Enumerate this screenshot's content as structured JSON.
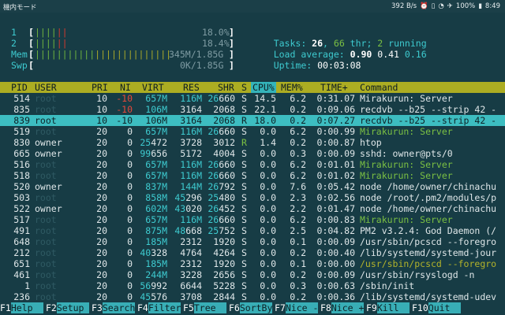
{
  "statusbar": {
    "left": "機内モード",
    "net": "392 B/s",
    "icons": [
      "alarm-icon",
      "vibrate-icon",
      "wifi-icon",
      "airplane-icon"
    ],
    "battery": "100%",
    "time": "8:49"
  },
  "meters": {
    "cpu1": {
      "label": "1",
      "value": "18.0",
      "bar_fraction": 0.18
    },
    "cpu2": {
      "label": "2",
      "value": "18.4",
      "bar_fraction": 0.18
    },
    "mem": {
      "label": "Mem",
      "value": "345M/1.85G",
      "bar_fraction": 0.55
    },
    "swp": {
      "label": "Swp",
      "value": "0K/1.85G",
      "bar_fraction": 0
    }
  },
  "summary": {
    "tasks_label": "Tasks: ",
    "tasks": "26",
    "sep": ", ",
    "thr": "66",
    "thr_label": " thr; ",
    "running": "2",
    "running_label": " running",
    "load_label": "Load average: ",
    "load1": "0.90",
    "load5": "0.41",
    "load15": "0.16",
    "uptime_label": "Uptime: ",
    "uptime": "00:03:08"
  },
  "columns": [
    "PID",
    "USER",
    "PRI",
    "NI",
    "VIRT",
    "RES",
    "SHR",
    "S",
    "CPU%",
    "MEM%",
    "TIME+",
    "Command"
  ],
  "processes": [
    {
      "pid": "514",
      "user": "root",
      "pri": "10",
      "ni": "-10",
      "virt": "657M",
      "res": "116M",
      "shr": "26660",
      "s": "S",
      "cpu": "14.5",
      "mem": "6.2",
      "time": "0:31.07",
      "cmd": "Mirakurun: Server"
    },
    {
      "pid": "835",
      "user": "root",
      "pri": "10",
      "ni": "-10",
      "virt": "106M",
      "res": "3164",
      "shr": "2068",
      "s": "S",
      "cpu": "22.1",
      "mem": "0.2",
      "time": "0:09.06",
      "cmd": "recdvb --b25 --strip 42 -"
    },
    {
      "pid": "839",
      "user": "root",
      "pri": "10",
      "ni": "-10",
      "virt": "106M",
      "res": "3164",
      "shr": "2068",
      "s": "R",
      "cpu": "18.0",
      "mem": "0.2",
      "time": "0:07.27",
      "cmd": "recdvb --b25 --strip 42 -"
    },
    {
      "pid": "519",
      "user": "root",
      "pri": "20",
      "ni": "0",
      "virt": "657M",
      "res": "116M",
      "shr": "26660",
      "s": "S",
      "cpu": "0.0",
      "mem": "6.2",
      "time": "0:00.99",
      "cmd": "Mirakurun: Server"
    },
    {
      "pid": "830",
      "user": "owner",
      "pri": "20",
      "ni": "0",
      "virt": "25472",
      "res": "3728",
      "shr": "3012",
      "s": "R",
      "cpu": "1.4",
      "mem": "0.2",
      "time": "0:00.87",
      "cmd": "htop"
    },
    {
      "pid": "665",
      "user": "owner",
      "pri": "20",
      "ni": "0",
      "virt": "99656",
      "res": "5172",
      "shr": "4004",
      "s": "S",
      "cpu": "0.0",
      "mem": "0.3",
      "time": "0:00.09",
      "cmd": "sshd: owner@pts/0"
    },
    {
      "pid": "516",
      "user": "root",
      "pri": "20",
      "ni": "0",
      "virt": "657M",
      "res": "116M",
      "shr": "26660",
      "s": "S",
      "cpu": "0.0",
      "mem": "6.2",
      "time": "0:01.01",
      "cmd": "Mirakurun: Server"
    },
    {
      "pid": "518",
      "user": "root",
      "pri": "20",
      "ni": "0",
      "virt": "657M",
      "res": "116M",
      "shr": "26660",
      "s": "S",
      "cpu": "0.0",
      "mem": "6.2",
      "time": "0:01.02",
      "cmd": "Mirakurun: Server"
    },
    {
      "pid": "520",
      "user": "owner",
      "pri": "20",
      "ni": "0",
      "virt": "837M",
      "res": "144M",
      "shr": "26792",
      "s": "S",
      "cpu": "0.0",
      "mem": "7.6",
      "time": "0:05.42",
      "cmd": "node /home/owner/chinachu"
    },
    {
      "pid": "503",
      "user": "root",
      "pri": "20",
      "ni": "0",
      "virt": "858M",
      "res": "45296",
      "shr": "25480",
      "s": "S",
      "cpu": "0.0",
      "mem": "2.3",
      "time": "0:02.56",
      "cmd": "node /root/.pm2/modules/p"
    },
    {
      "pid": "522",
      "user": "owner",
      "pri": "20",
      "ni": "0",
      "virt": "602M",
      "res": "43020",
      "shr": "26452",
      "s": "S",
      "cpu": "0.0",
      "mem": "2.2",
      "time": "0:01.47",
      "cmd": "node /home/owner/chinachu"
    },
    {
      "pid": "517",
      "user": "root",
      "pri": "20",
      "ni": "0",
      "virt": "657M",
      "res": "116M",
      "shr": "26660",
      "s": "S",
      "cpu": "0.0",
      "mem": "6.2",
      "time": "0:00.83",
      "cmd": "Mirakurun: Server"
    },
    {
      "pid": "491",
      "user": "root",
      "pri": "20",
      "ni": "0",
      "virt": "875M",
      "res": "48668",
      "shr": "25752",
      "s": "S",
      "cpu": "0.0",
      "mem": "2.5",
      "time": "0:04.82",
      "cmd": "PM2 v3.2.4: God Daemon (/"
    },
    {
      "pid": "648",
      "user": "root",
      "pri": "20",
      "ni": "0",
      "virt": "185M",
      "res": "2312",
      "shr": "1920",
      "s": "S",
      "cpu": "0.0",
      "mem": "0.1",
      "time": "0:00.09",
      "cmd": "/usr/sbin/pcscd --foregro"
    },
    {
      "pid": "212",
      "user": "root",
      "pri": "20",
      "ni": "0",
      "virt": "40328",
      "res": "4764",
      "shr": "4264",
      "s": "S",
      "cpu": "0.0",
      "mem": "0.2",
      "time": "0:00.40",
      "cmd": "/lib/systemd/systemd-jour"
    },
    {
      "pid": "651",
      "user": "root",
      "pri": "20",
      "ni": "0",
      "virt": "185M",
      "res": "2312",
      "shr": "1920",
      "s": "S",
      "cpu": "0.0",
      "mem": "0.1",
      "time": "0:00.00",
      "cmd": "/usr/sbin/pcscd --foregro"
    },
    {
      "pid": "461",
      "user": "root",
      "pri": "20",
      "ni": "0",
      "virt": "244M",
      "res": "3228",
      "shr": "2656",
      "s": "S",
      "cpu": "0.0",
      "mem": "0.2",
      "time": "0:00.09",
      "cmd": "/usr/sbin/rsyslogd -n"
    },
    {
      "pid": "1",
      "user": "root",
      "pri": "20",
      "ni": "0",
      "virt": "56992",
      "res": "6644",
      "shr": "5228",
      "s": "S",
      "cpu": "0.0",
      "mem": "0.3",
      "time": "0:00.63",
      "cmd": "/sbin/init"
    },
    {
      "pid": "236",
      "user": "root",
      "pri": "20",
      "ni": "0",
      "virt": "45576",
      "res": "3708",
      "shr": "2844",
      "s": "S",
      "cpu": "0.0",
      "mem": "0.2",
      "time": "0:00.36",
      "cmd": "/lib/systemd/systemd-udev"
    }
  ],
  "fkeys": [
    {
      "num": "F1",
      "label": "Help  "
    },
    {
      "num": "F2",
      "label": "Setup "
    },
    {
      "num": "F3",
      "label": "Search"
    },
    {
      "num": "F4",
      "label": "Filter"
    },
    {
      "num": "F5",
      "label": "Tree  "
    },
    {
      "num": "F6",
      "label": "SortBy"
    },
    {
      "num": "F7",
      "label": "Nice -"
    },
    {
      "num": "F8",
      "label": "Nice +"
    },
    {
      "num": "F9",
      "label": "Kill  "
    },
    {
      "num": "F10",
      "label": "Quit  "
    }
  ]
}
